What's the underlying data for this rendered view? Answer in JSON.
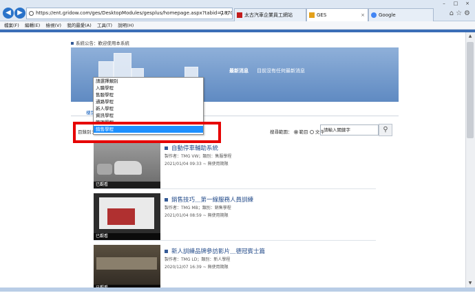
{
  "browser": {
    "url": "https://ent.gridow.com/ges/DesktopModules/gesplus/homepage.aspx?tabid=18701",
    "tabs": [
      {
        "label": "太古汽車企業員工網站"
      },
      {
        "label": "GES"
      },
      {
        "label": "Google"
      }
    ],
    "menu": [
      "檔案(F)",
      "編輯(E)",
      "檢視(V)",
      "我的最愛(A)",
      "工具(T)",
      "說明(H)"
    ]
  },
  "page": {
    "announcement": "系統公告：歡迎使用本系統",
    "news_title": "最新消息",
    "news_text": "目前沒有任何最新消息",
    "tab_label": "樓別",
    "filter_label": "目錄別：",
    "dropdown": {
      "options": [
        "請選擇類別",
        "入職學程",
        "售服學程",
        "通路學程",
        "新人學程",
        "資訊學程",
        "管理學程",
        "銷售學程"
      ],
      "selected_index": 7
    },
    "search": {
      "label": "搜尋範圍：",
      "opt_title": "範目",
      "opt_text": "文件",
      "placeholder": "請輸入關鍵字"
    },
    "courses": [
      {
        "title": "自動停車輔助系統",
        "meta": "製作者：TMG VW；類別：售服學程",
        "date": "2021/01/04 09:33 ~ 無使用期限",
        "badge": "已觀看"
      },
      {
        "title": "銷售技巧＿第一線服務人員訓練",
        "meta": "製作者：TMG MB；類別：銷售學程",
        "date": "2021/01/04 08:59 ~ 無使用期限",
        "badge": "已觀看"
      },
      {
        "title": "新人訓練品牌參訪影片＿德冠賓士篇",
        "meta": "製作者：TMG LD；類別：新人學程",
        "date": "2020/12/07 16:39 ~ 無使用期限",
        "badge": "已觀看"
      }
    ]
  },
  "colors": {
    "accent": "#3a6db6",
    "highlight": "#1e90ff",
    "annotation": "#e60000"
  }
}
